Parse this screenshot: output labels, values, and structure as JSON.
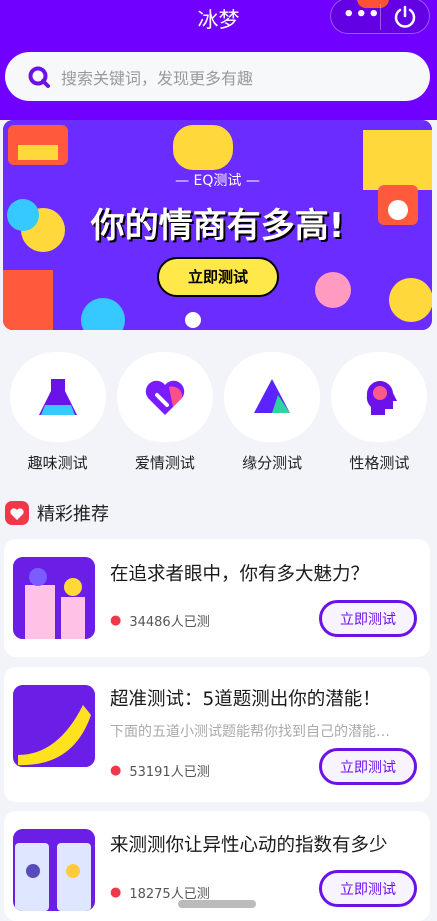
{
  "header": {
    "title": "冰梦",
    "more_icon": "more-dots-icon",
    "power_icon": "power-icon"
  },
  "search": {
    "placeholder": "搜索关键词，发现更多有趣"
  },
  "banner": {
    "tag": "— EQ测试 —",
    "headline": "你的情商有多高!",
    "button": "立即测试"
  },
  "categories": [
    {
      "label": "趣味测试",
      "icon": "flask-icon"
    },
    {
      "label": "爱情测试",
      "icon": "heart-icon"
    },
    {
      "label": "缘分测试",
      "icon": "triangle-icon"
    },
    {
      "label": "性格测试",
      "icon": "head-icon"
    }
  ],
  "section": {
    "title": "精彩推荐"
  },
  "cards": [
    {
      "title": "在追求者眼中，你有多大魅力？",
      "desc": "",
      "count": "34486人已测",
      "button": "立即测试"
    },
    {
      "title": "超准测试：5道题测出你的潜能！",
      "desc": "下面的五道小测试题能帮你找到自己的潜能…",
      "count": "53191人已测",
      "button": "立即测试"
    },
    {
      "title": "来测测你让异性心动的指数有多少",
      "desc": "",
      "count": "18275人已测",
      "button": "立即测试"
    }
  ],
  "colors": {
    "brand": "#7000ff",
    "badge": "#ff5136",
    "fire": "#f0384a"
  }
}
